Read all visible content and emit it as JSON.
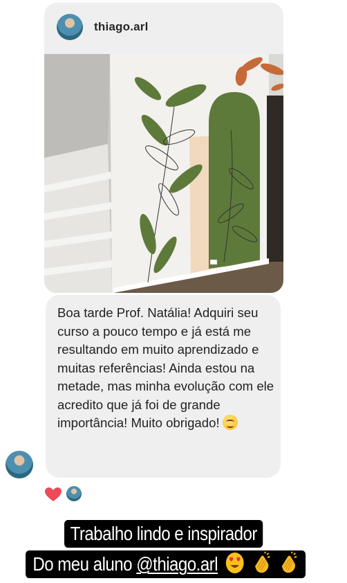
{
  "shared_post": {
    "username": "thiago.arl",
    "photo_description": "mural"
  },
  "message": {
    "text": "Boa tarde Prof. Natália! Adquiri seu curso a pouco tempo e já está me resultando em muito aprendizado e muitas referências! Ainda estou na metade, mas minha evolução com ele acredito que já foi de grande importância! Muito obrigado!",
    "emoji": "smiling-face-icon"
  },
  "reactions": {
    "heart": "heart-icon"
  },
  "captions": {
    "line1": "Trabalho lindo e inspirador",
    "line2_prefix": "Do meu aluno ",
    "line2_mention": "@thiago.arl",
    "line2_emojis": [
      "heart-eyes-icon",
      "clapping-hands-icon",
      "clapping-hands-icon"
    ]
  },
  "colors": {
    "bubble": "#efefef",
    "caption_bg": "#000000",
    "heart": "#ed4956",
    "mural_green": "#5e7a3a"
  }
}
